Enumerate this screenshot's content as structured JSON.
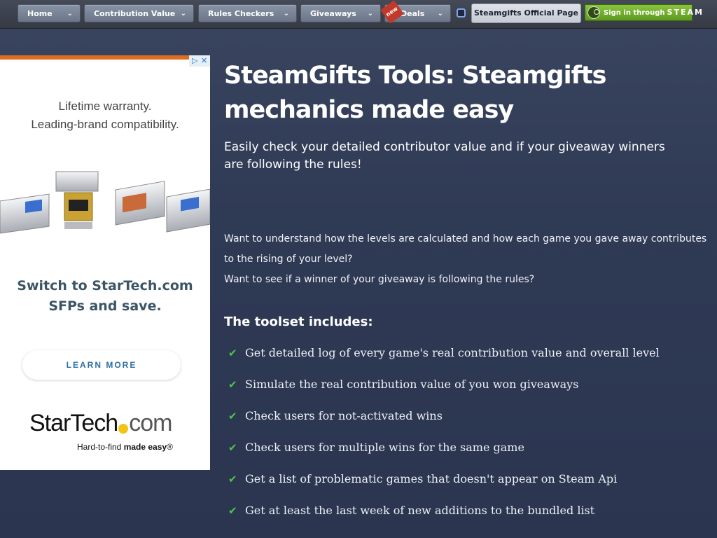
{
  "nav": {
    "items": [
      {
        "label": "Home"
      },
      {
        "label": "Contribution Value"
      },
      {
        "label": "Rules Checkers"
      },
      {
        "label": "Giveaways"
      },
      {
        "label": "Deals",
        "badge": "new"
      }
    ],
    "official_label": "Steamgifts Official Page",
    "steam_signin": {
      "prefix": "Sign in through",
      "brand": "STEAM"
    }
  },
  "ad": {
    "tagline_line1": "Lifetime warranty.",
    "tagline_line2": "Leading-brand compatibility.",
    "headline_line1": "Switch to StarTech.com",
    "headline_line2": "SFPs and save.",
    "cta": "LEARN MORE",
    "brand_left": "StarTech",
    "brand_right": "com",
    "slogan_prefix": "Hard-to-find ",
    "slogan_bold": "made easy",
    "slogan_mark": "®",
    "accent": "#e06c1f"
  },
  "main": {
    "title": "SteamGifts Tools: Steamgifts mechanics made easy",
    "subtitle": "Easily check your detailed contributor value and if your giveaway winners are following the rules!",
    "para_line1": "Want to understand how the levels are calculated and how each game you gave away contributes to the rising of your level?",
    "para_line2": "Want to see if a winner of your giveaway is following the rules?",
    "toolset_title": "The toolset includes:",
    "features": [
      "Get detailed log of every game's real contribution value and overall level",
      "Simulate the real contribution value of you won giveaways",
      "Check users for not-activated wins",
      "Check users for multiple wins for the same game",
      "Get a list of problematic games that doesn't appear on Steam Api",
      "Get at least the last week of new additions to the bundled list"
    ]
  }
}
